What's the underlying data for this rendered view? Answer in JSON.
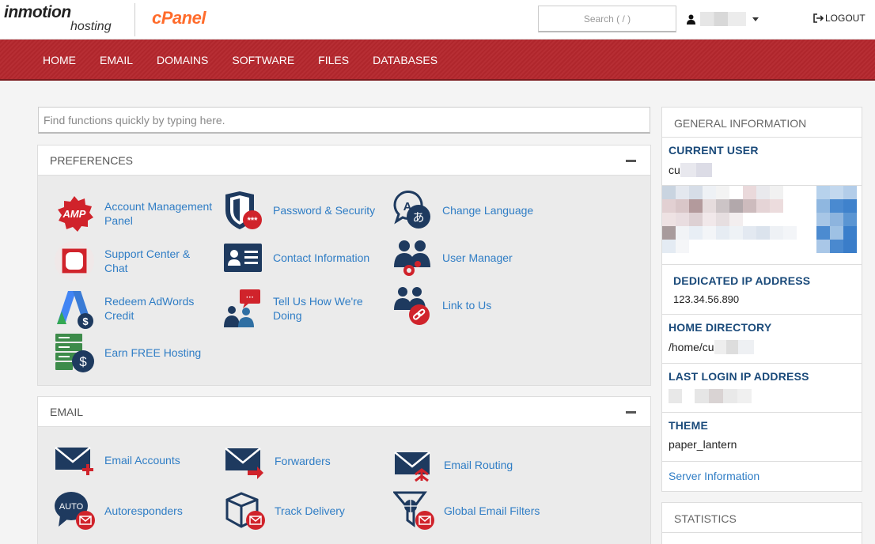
{
  "header": {
    "brand": "inmotion",
    "brand_sub": "hosting",
    "product": "cPanel",
    "search_placeholder": "Search ( / )",
    "logout_label": "LOGOUT"
  },
  "nav": [
    "HOME",
    "EMAIL",
    "DOMAINS",
    "SOFTWARE",
    "FILES",
    "DATABASES"
  ],
  "find": {
    "placeholder": "Find functions quickly by typing here."
  },
  "preferences": {
    "title": "PREFERENCES",
    "items": [
      {
        "label": "Account Management Panel",
        "icon": "amp-icon"
      },
      {
        "label": "Password & Security",
        "icon": "shield-icon"
      },
      {
        "label": "Change Language",
        "icon": "language-icon"
      },
      {
        "label": "Support Center & Chat",
        "icon": "support-icon"
      },
      {
        "label": "Contact Information",
        "icon": "contact-card-icon"
      },
      {
        "label": "User Manager",
        "icon": "users-gear-icon"
      },
      {
        "label": "Redeem AdWords Credit",
        "icon": "adwords-icon"
      },
      {
        "label": "Tell Us How We're Doing",
        "icon": "feedback-icon"
      },
      {
        "label": "Link to Us",
        "icon": "link-users-icon"
      },
      {
        "label": "Earn FREE Hosting",
        "icon": "server-dollar-icon"
      }
    ]
  },
  "email": {
    "title": "EMAIL",
    "items": [
      {
        "label": "Email Accounts",
        "icon": "mail-plus-icon"
      },
      {
        "label": "Forwarders",
        "icon": "mail-forward-icon"
      },
      {
        "label": "Email Routing",
        "icon": "mail-route-icon"
      },
      {
        "label": "Autoresponders",
        "icon": "auto-bubble-icon",
        "badge": "AUTO"
      },
      {
        "label": "Track Delivery",
        "icon": "box-mail-icon"
      },
      {
        "label": "Global Email Filters",
        "icon": "globe-filter-icon"
      }
    ]
  },
  "sidebar": {
    "general_title": "GENERAL INFORMATION",
    "current_user_label": "CURRENT USER",
    "current_user_value": "cu",
    "dedicated_ip_label": "DEDICATED IP ADDRESS",
    "dedicated_ip_value": "123.34.56.890",
    "home_dir_label": "HOME DIRECTORY",
    "home_dir_value": "/home/cu",
    "last_login_label": "LAST LOGIN IP ADDRESS",
    "theme_label": "THEME",
    "theme_value": "paper_lantern",
    "server_info_link": "Server Information",
    "statistics_title": "STATISTICS"
  },
  "colors": {
    "nav_bg": "#b5272d",
    "link": "#2f7dc5",
    "icon_navy": "#1e3a5f",
    "icon_red": "#d0232b",
    "cpanel_orange": "#ff6c2c"
  }
}
